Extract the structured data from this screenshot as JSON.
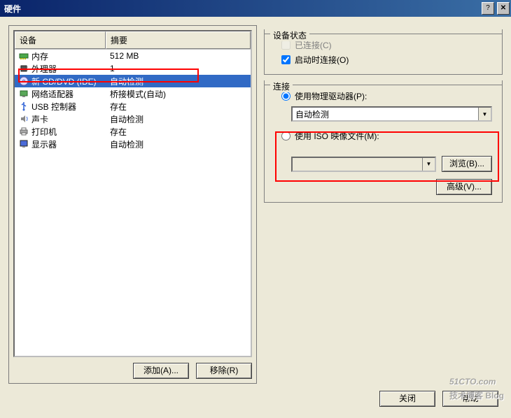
{
  "window": {
    "title": "硬件"
  },
  "list": {
    "header_device": "设备",
    "header_summary": "摘要",
    "rows": [
      {
        "icon": "memory-icon",
        "device": "内存",
        "summary": "512 MB"
      },
      {
        "icon": "cpu-icon",
        "device": "外理器",
        "summary": "1"
      },
      {
        "icon": "cd-icon",
        "device": "新 CD/DVD (IDE)",
        "summary": "自动检测",
        "selected": true
      },
      {
        "icon": "network-icon",
        "device": "网络适配器",
        "summary": "桥接模式(自动)"
      },
      {
        "icon": "usb-icon",
        "device": "USB 控制器",
        "summary": "存在"
      },
      {
        "icon": "sound-icon",
        "device": "声卡",
        "summary": "自动检测"
      },
      {
        "icon": "printer-icon",
        "device": "打印机",
        "summary": "存在"
      },
      {
        "icon": "display-icon",
        "device": "显示器",
        "summary": "自动检测"
      }
    ]
  },
  "buttons": {
    "add": "添加(A)...",
    "remove": "移除(R)",
    "ok": "关闭",
    "help": "帮助",
    "advanced": "高级(V)...",
    "browse": "浏览(B)..."
  },
  "status_group": {
    "title": "设备状态",
    "connected": "已连接(C)",
    "connect_at_poweron": "启动时连接(O)"
  },
  "connection_group": {
    "title": "连接",
    "use_physical": "使用物理驱动器(P):",
    "physical_value": "自动检测",
    "use_iso": "使用 ISO 映像文件(M):",
    "iso_value": ""
  },
  "watermark": {
    "main": "51CTO.com",
    "sub": "技术博客  Blog"
  }
}
